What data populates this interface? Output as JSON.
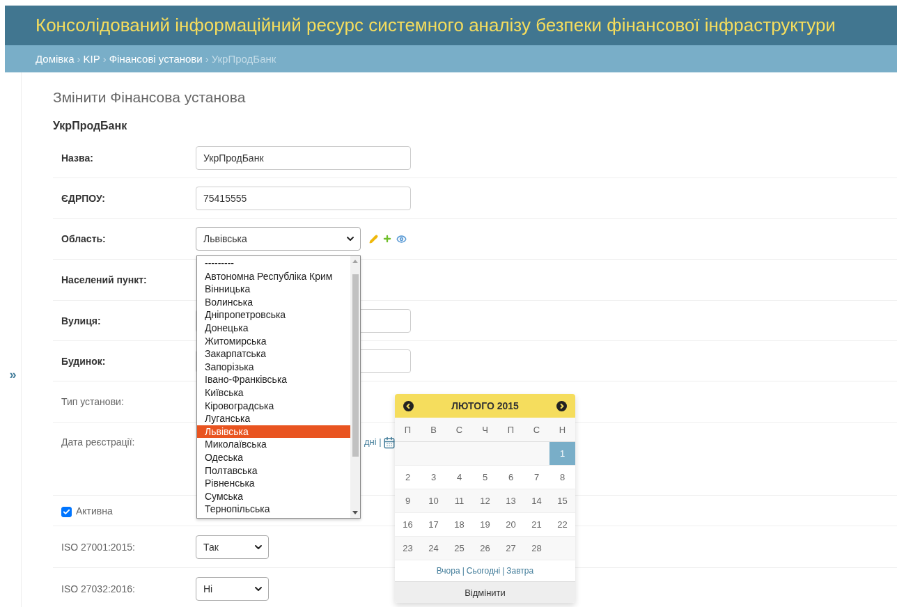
{
  "header": {
    "title": "Консолідований інформаційний ресурс системного аналізу безпеки фінансової інфраструктури"
  },
  "breadcrumbs": [
    {
      "label": "Домівка",
      "current": false
    },
    {
      "label": "KIP",
      "current": false
    },
    {
      "label": "Фінансові установи",
      "current": false
    },
    {
      "label": "УкрПродБанк",
      "current": true
    }
  ],
  "breadcrumb_separator": "›",
  "sidebar": {
    "toggle": "»"
  },
  "page_title": "Змінити Фінансова установа",
  "object_title": "УкрПродБанк",
  "fields": [
    {
      "kind": "input",
      "label": "Назва:",
      "required": true,
      "value": "УкрПродБанк"
    },
    {
      "kind": "input",
      "label": "ЄДРПОУ:",
      "required": true,
      "value": "75415555"
    },
    {
      "kind": "related",
      "label": "Область:",
      "required": true,
      "value": "Львівська"
    },
    {
      "kind": "blank",
      "label": "Населений пункт:",
      "required": true
    },
    {
      "kind": "input",
      "label": "Вулиця:",
      "required": true
    },
    {
      "kind": "input",
      "label": "Будинок:",
      "required": true
    },
    {
      "kind": "blank",
      "label": "Тип установи:",
      "required": false
    },
    {
      "kind": "date",
      "label": "Дата реєстрації:",
      "required": false,
      "shortcut_tail": "дні |"
    },
    {
      "kind": "checkbox",
      "label": "Активна",
      "checked": true
    },
    {
      "kind": "select",
      "label": "ISO 27001:2015:",
      "required": false,
      "value": "Так"
    },
    {
      "kind": "select",
      "label": "ISO 27032:2016:",
      "required": false,
      "value": "Ні"
    }
  ],
  "region_dropdown": {
    "options": [
      {
        "label": "---------",
        "selected": false
      },
      {
        "label": "Автономна Республіка Крим",
        "selected": false
      },
      {
        "label": "Вінницька",
        "selected": false
      },
      {
        "label": "Волинська",
        "selected": false
      },
      {
        "label": "Дніпропетровська",
        "selected": false
      },
      {
        "label": "Донецька",
        "selected": false
      },
      {
        "label": "Житомирська",
        "selected": false
      },
      {
        "label": "Закарпатська",
        "selected": false
      },
      {
        "label": "Запорізька",
        "selected": false
      },
      {
        "label": "Івано-Франківська",
        "selected": false
      },
      {
        "label": "Київська",
        "selected": false
      },
      {
        "label": "Кіровоградська",
        "selected": false
      },
      {
        "label": "Луганська",
        "selected": false
      },
      {
        "label": "Львівська",
        "selected": true
      },
      {
        "label": "Миколаївська",
        "selected": false
      },
      {
        "label": "Одеська",
        "selected": false
      },
      {
        "label": "Полтавська",
        "selected": false
      },
      {
        "label": "Рівненська",
        "selected": false
      },
      {
        "label": "Сумська",
        "selected": false
      },
      {
        "label": "Тернопільська",
        "selected": false
      }
    ]
  },
  "calendar": {
    "month": "ЛЮТОГО 2015",
    "weekdays": [
      "П",
      "В",
      "С",
      "Ч",
      "П",
      "С",
      "Н"
    ],
    "weeks": [
      [
        {
          "kind": "empty"
        },
        {
          "kind": "empty"
        },
        {
          "kind": "empty"
        },
        {
          "kind": "empty"
        },
        {
          "kind": "empty"
        },
        {
          "kind": "empty"
        },
        {
          "kind": "day",
          "label": "1",
          "selected": true
        }
      ],
      [
        {
          "label": "2",
          "selected": false
        },
        {
          "label": "3",
          "selected": false
        },
        {
          "label": "4",
          "selected": false
        },
        {
          "label": "5",
          "selected": false
        },
        {
          "label": "6",
          "selected": false
        },
        {
          "label": "7",
          "selected": false
        },
        {
          "label": "8",
          "selected": false
        }
      ],
      [
        {
          "label": "9",
          "selected": false
        },
        {
          "label": "10",
          "selected": false
        },
        {
          "label": "11",
          "selected": false
        },
        {
          "label": "12",
          "selected": false
        },
        {
          "label": "13",
          "selected": false
        },
        {
          "label": "14",
          "selected": false
        },
        {
          "label": "15",
          "selected": false
        }
      ],
      [
        {
          "label": "16",
          "selected": false
        },
        {
          "label": "17",
          "selected": false
        },
        {
          "label": "18",
          "selected": false
        },
        {
          "label": "19",
          "selected": false
        },
        {
          "label": "20",
          "selected": false
        },
        {
          "label": "21",
          "selected": false
        },
        {
          "label": "22",
          "selected": false
        }
      ],
      [
        {
          "label": "23",
          "selected": false
        },
        {
          "label": "24",
          "selected": false
        },
        {
          "label": "25",
          "selected": false
        },
        {
          "label": "26",
          "selected": false
        },
        {
          "label": "27",
          "selected": false
        },
        {
          "label": "28",
          "selected": false
        },
        {
          "kind": "empty"
        }
      ]
    ],
    "quick_links": [
      "Вчора",
      "Сьогодні",
      "Завтра"
    ],
    "separator": "|",
    "cancel": "Відмінити"
  }
}
